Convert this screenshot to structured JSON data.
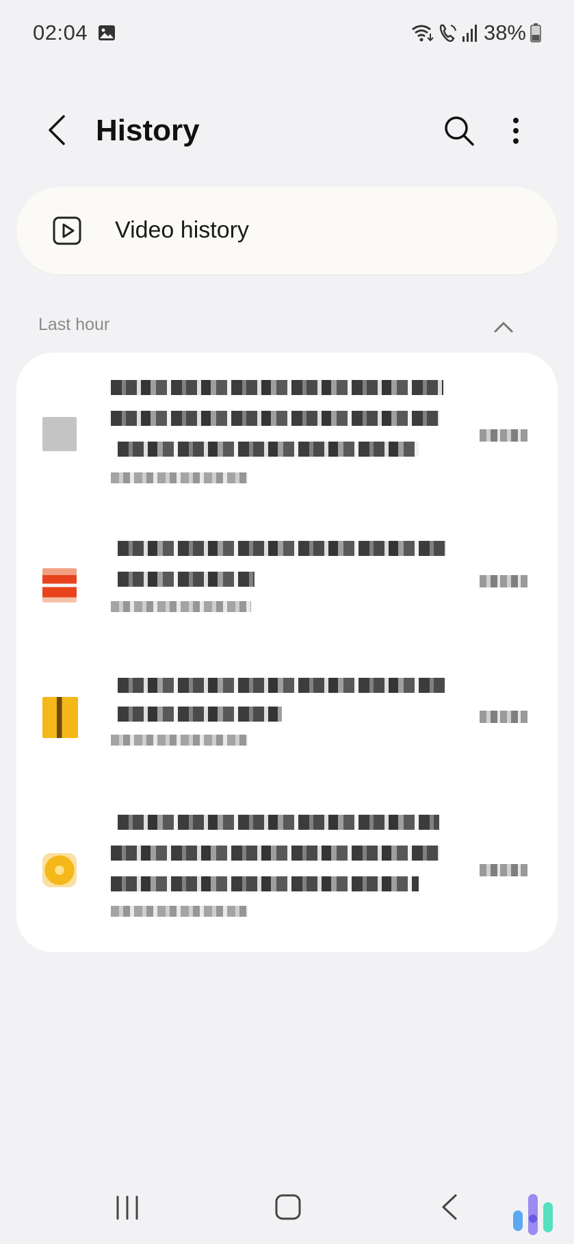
{
  "status_bar": {
    "time": "02:04",
    "battery": "38%"
  },
  "app_bar": {
    "title": "History"
  },
  "video_history": {
    "label": "Video history"
  },
  "section": {
    "title": "Last hour"
  },
  "colors": {
    "background": "#f2f2f4",
    "card": "#ffffff",
    "video_card": "#fbfaf6",
    "section_title": "#8a8a8a"
  },
  "icons": {
    "back": "chevron-left-icon",
    "search": "search-icon",
    "more": "more-vertical-icon",
    "video": "play-square-icon",
    "collapse": "chevron-up-icon"
  }
}
